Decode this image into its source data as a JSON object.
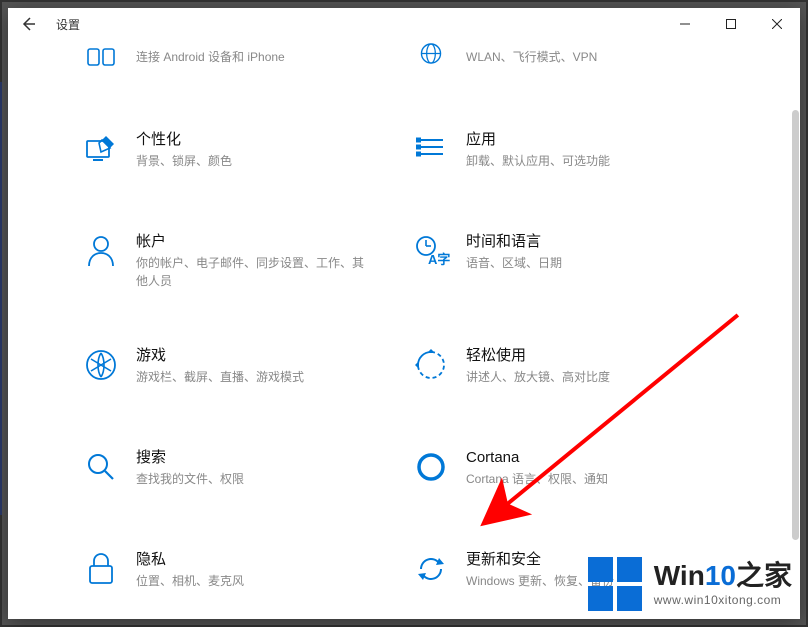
{
  "window": {
    "title": "设置"
  },
  "tiles": [
    {
      "title": "",
      "desc": "连接 Android 设备和 iPhone"
    },
    {
      "title": "",
      "desc": "WLAN、飞行模式、VPN"
    },
    {
      "title": "个性化",
      "desc": "背景、锁屏、颜色"
    },
    {
      "title": "应用",
      "desc": "卸载、默认应用、可选功能"
    },
    {
      "title": "帐户",
      "desc": "你的帐户、电子邮件、同步设置、工作、其他人员"
    },
    {
      "title": "时间和语言",
      "desc": "语音、区域、日期"
    },
    {
      "title": "游戏",
      "desc": "游戏栏、截屏、直播、游戏模式"
    },
    {
      "title": "轻松使用",
      "desc": "讲述人、放大镜、高对比度"
    },
    {
      "title": "搜索",
      "desc": "查找我的文件、权限"
    },
    {
      "title": "Cortana",
      "desc": "Cortana 语言、权限、通知"
    },
    {
      "title": "隐私",
      "desc": "位置、相机、麦克风"
    },
    {
      "title": "更新和安全",
      "desc": "Windows 更新、恢复、备份"
    }
  ],
  "watermark": {
    "brand_prefix": "Win",
    "brand_accent": "10",
    "brand_suffix": "之家",
    "url": "www.win10xitong.com"
  },
  "colors": {
    "accent": "#0078D7",
    "arrow": "#ff0000"
  }
}
